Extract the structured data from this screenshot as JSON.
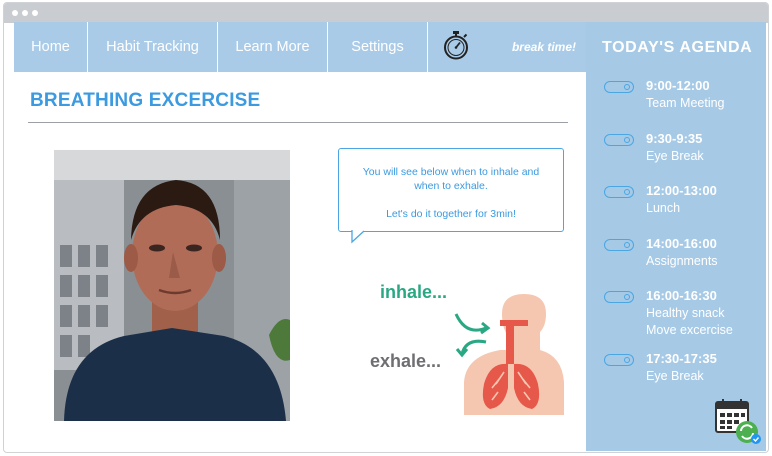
{
  "nav": {
    "items": [
      "Home",
      "Habit Tracking",
      "Learn More",
      "Settings"
    ],
    "break_label": "break time!",
    "timer_icon": "stopwatch-icon"
  },
  "main": {
    "title": "BREATHING EXCERCISE",
    "instruction_line1": "You will see below when to inhale and",
    "instruction_line2": "when to exhale.",
    "instruction_line3": "Let's do it together for 3min!",
    "inhale_label": "inhale...",
    "exhale_label": "exhale..."
  },
  "agenda": {
    "title": "TODAY'S AGENDA",
    "items": [
      {
        "time": "9:00-12:00",
        "label": "Team Meeting"
      },
      {
        "time": "9:30-9:35",
        "label": "Eye Break"
      },
      {
        "time": "12:00-13:00",
        "label": "Lunch"
      },
      {
        "time": "14:00-16:00",
        "label": "Assignments"
      },
      {
        "time": "16:00-16:30",
        "label": "Healthy snack",
        "label2": "Move excercise"
      },
      {
        "time": "17:30-17:35",
        "label": "Eye Break"
      }
    ]
  },
  "colors": {
    "accent": "#3b9ae0",
    "nav_bg": "#a9cbe8",
    "sidebar_bg": "#a6c9e6",
    "inhale": "#2aa883",
    "exhale": "#6f6f73"
  }
}
